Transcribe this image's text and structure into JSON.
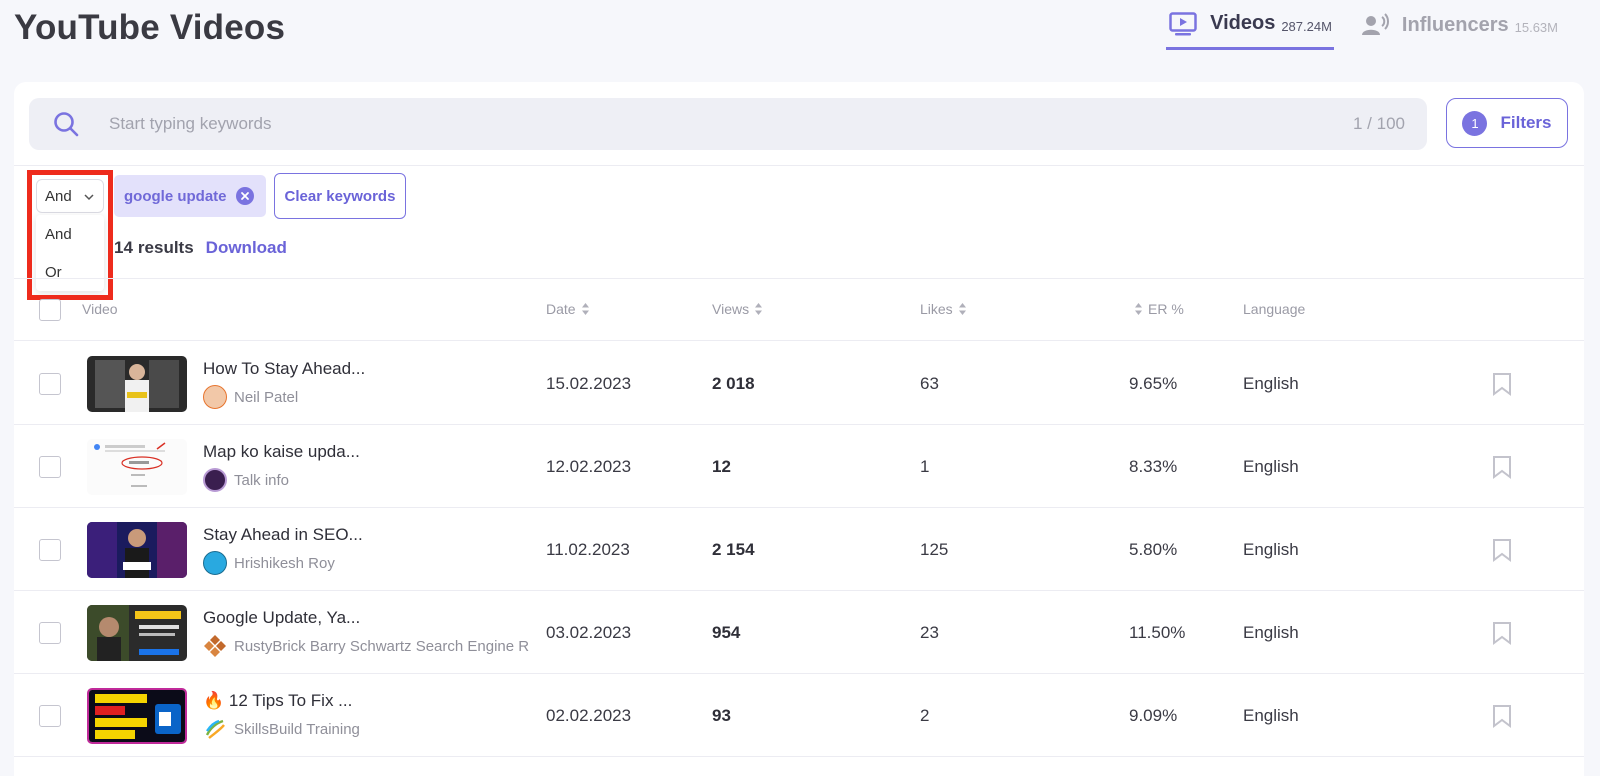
{
  "page": {
    "title": "YouTube Videos"
  },
  "tabs": [
    {
      "label": "Videos",
      "count": "287.24M",
      "icon": "tv-play-icon",
      "active": true
    },
    {
      "label": "Influencers",
      "count": "15.63M",
      "icon": "influencer-icon",
      "active": false
    }
  ],
  "search": {
    "placeholder": "Start typing keywords",
    "counter": "1 / 100"
  },
  "filters": {
    "label": "Filters",
    "badge": "1"
  },
  "operator": {
    "selected": "And",
    "options": [
      "And",
      "Or"
    ]
  },
  "keywords": [
    {
      "text": "google update"
    }
  ],
  "clear_keywords_label": "Clear keywords",
  "results": {
    "count": "14",
    "label": "results",
    "download_label": "Download"
  },
  "table": {
    "columns": {
      "video": "Video",
      "date": "Date",
      "views": "Views",
      "likes": "Likes",
      "er": "ER %",
      "language": "Language"
    },
    "rows": [
      {
        "title": "How To Stay Ahead...",
        "channel": "Neil Patel",
        "date": "15.02.2023",
        "views": "2 018",
        "likes": "63",
        "er": "9.65%",
        "language": "English"
      },
      {
        "title": "Map ko kaise upda...",
        "channel": "Talk info",
        "date": "12.02.2023",
        "views": "12",
        "likes": "1",
        "er": "8.33%",
        "language": "English"
      },
      {
        "title": "Stay Ahead in SEO...",
        "channel": "Hrishikesh Roy",
        "date": "11.02.2023",
        "views": "2 154",
        "likes": "125",
        "er": "5.80%",
        "language": "English"
      },
      {
        "title": "Google Update, Ya...",
        "channel": "RustyBrick Barry Schwartz Search Engine R",
        "date": "03.02.2023",
        "views": "954",
        "likes": "23",
        "er": "11.50%",
        "language": "English"
      },
      {
        "title": "🔥 12 Tips To Fix ...",
        "channel": "SkillsBuild Training",
        "date": "02.02.2023",
        "views": "93",
        "likes": "2",
        "er": "9.09%",
        "language": "English"
      }
    ]
  },
  "colors": {
    "accent": "#7a73e0",
    "highlight": "#ee2b1c",
    "chip_bg": "#e3e1fb"
  }
}
